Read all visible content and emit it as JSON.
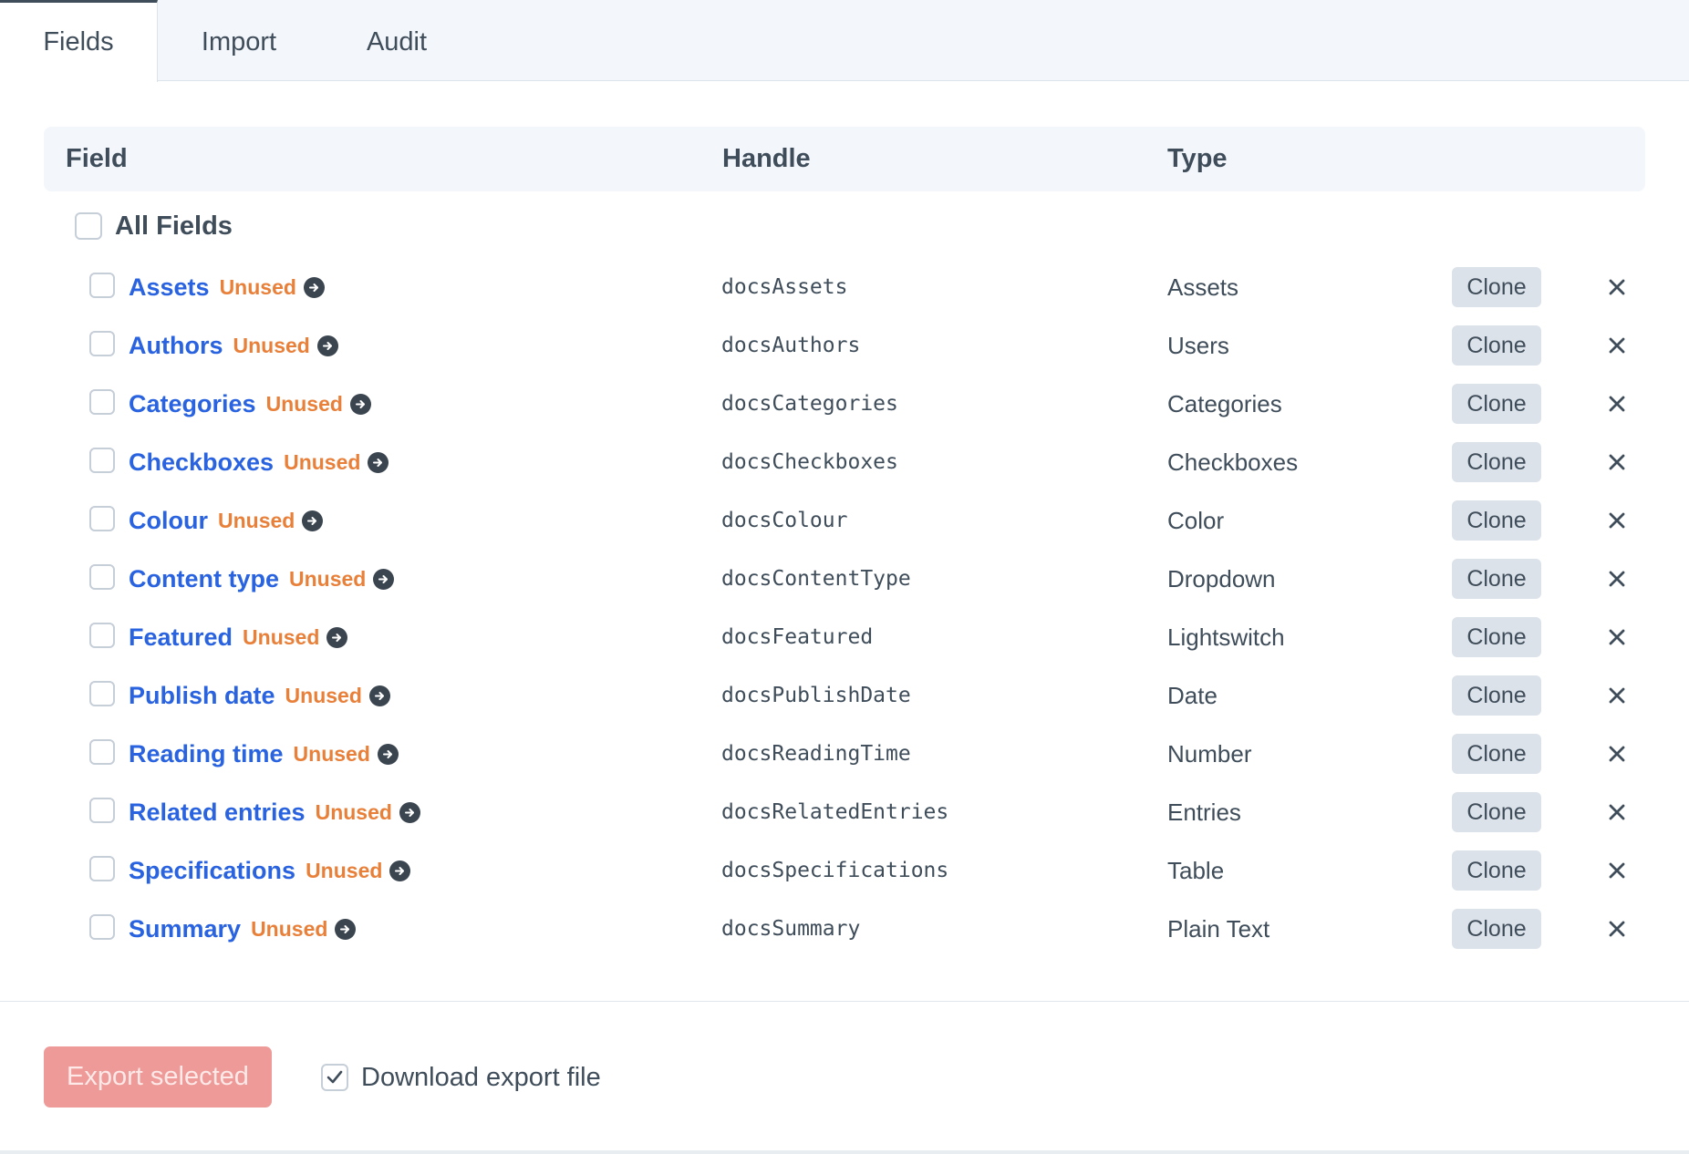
{
  "tabs": [
    {
      "label": "Fields",
      "active": true
    },
    {
      "label": "Import",
      "active": false
    },
    {
      "label": "Audit",
      "active": false
    }
  ],
  "table": {
    "headers": {
      "field": "Field",
      "handle": "Handle",
      "type": "Type"
    },
    "all_fields_label": "All Fields",
    "rows": [
      {
        "name": "Assets",
        "status": "Unused",
        "handle": "docsAssets",
        "type": "Assets",
        "clone_label": "Clone"
      },
      {
        "name": "Authors",
        "status": "Unused",
        "handle": "docsAuthors",
        "type": "Users",
        "clone_label": "Clone"
      },
      {
        "name": "Categories",
        "status": "Unused",
        "handle": "docsCategories",
        "type": "Categories",
        "clone_label": "Clone"
      },
      {
        "name": "Checkboxes",
        "status": "Unused",
        "handle": "docsCheckboxes",
        "type": "Checkboxes",
        "clone_label": "Clone"
      },
      {
        "name": "Colour",
        "status": "Unused",
        "handle": "docsColour",
        "type": "Color",
        "clone_label": "Clone"
      },
      {
        "name": "Content type",
        "status": "Unused",
        "handle": "docsContentType",
        "type": "Dropdown",
        "clone_label": "Clone"
      },
      {
        "name": "Featured",
        "status": "Unused",
        "handle": "docsFeatured",
        "type": "Lightswitch",
        "clone_label": "Clone"
      },
      {
        "name": "Publish date",
        "status": "Unused",
        "handle": "docsPublishDate",
        "type": "Date",
        "clone_label": "Clone"
      },
      {
        "name": "Reading time",
        "status": "Unused",
        "handle": "docsReadingTime",
        "type": "Number",
        "clone_label": "Clone"
      },
      {
        "name": "Related entries",
        "status": "Unused",
        "handle": "docsRelatedEntries",
        "type": "Entries",
        "clone_label": "Clone"
      },
      {
        "name": "Specifications",
        "status": "Unused",
        "handle": "docsSpecifications",
        "type": "Table",
        "clone_label": "Clone"
      },
      {
        "name": "Summary",
        "status": "Unused",
        "handle": "docsSummary",
        "type": "Plain Text",
        "clone_label": "Clone"
      }
    ]
  },
  "footer": {
    "export_label": "Export selected",
    "download_label": "Download export file",
    "download_checked": true
  },
  "icons": {
    "row_link": "arrow-circle-right-icon",
    "row_delete": "close-icon",
    "download_check": "checkmark-icon"
  },
  "colors": {
    "link": "#2a63e0",
    "unused": "#e8803a",
    "export_button": "#ee9a98",
    "tab_bar": "#f3f7fc"
  }
}
